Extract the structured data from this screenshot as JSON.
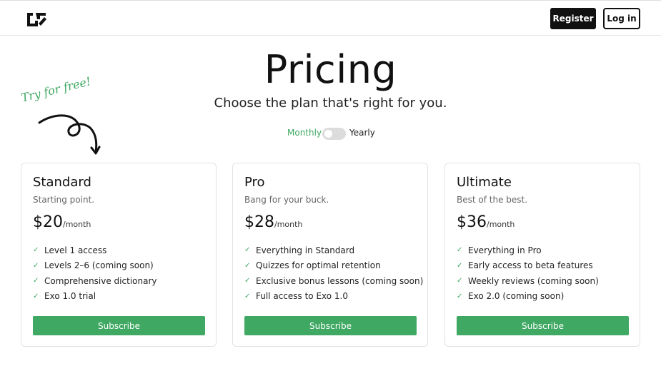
{
  "header": {
    "logo_icon": "brand-logo-icon",
    "register_label": "Register",
    "login_label": "Log in"
  },
  "hero": {
    "title": "Pricing",
    "subtitle": "Choose the plan that's right for you.",
    "callout": "Try for free!"
  },
  "billing_toggle": {
    "monthly_label": "Monthly",
    "yearly_label": "Yearly",
    "selected": "Monthly"
  },
  "plans": [
    {
      "name": "Standard",
      "tagline": "Starting point.",
      "price": "$20",
      "period": "/month",
      "features": [
        "Level 1 access",
        "Levels 2–6 (coming soon)",
        "Comprehensive dictionary",
        "Exo 1.0 trial"
      ],
      "cta": "Subscribe"
    },
    {
      "name": "Pro",
      "tagline": "Bang for your buck.",
      "price": "$28",
      "period": "/month",
      "features": [
        "Everything in Standard",
        "Quizzes for optimal retention",
        "Exclusive bonus lessons (coming soon)",
        "Full access to Exo 1.0"
      ],
      "cta": "Subscribe"
    },
    {
      "name": "Ultimate",
      "tagline": "Best of the best.",
      "price": "$36",
      "period": "/month",
      "features": [
        "Everything in Pro",
        "Early access to beta features",
        "Weekly reviews (coming soon)",
        "Exo 2.0 (coming soon)"
      ],
      "cta": "Subscribe"
    }
  ],
  "colors": {
    "accent": "#3fa862",
    "dark": "#111111"
  },
  "icons": {
    "check": "✓"
  }
}
